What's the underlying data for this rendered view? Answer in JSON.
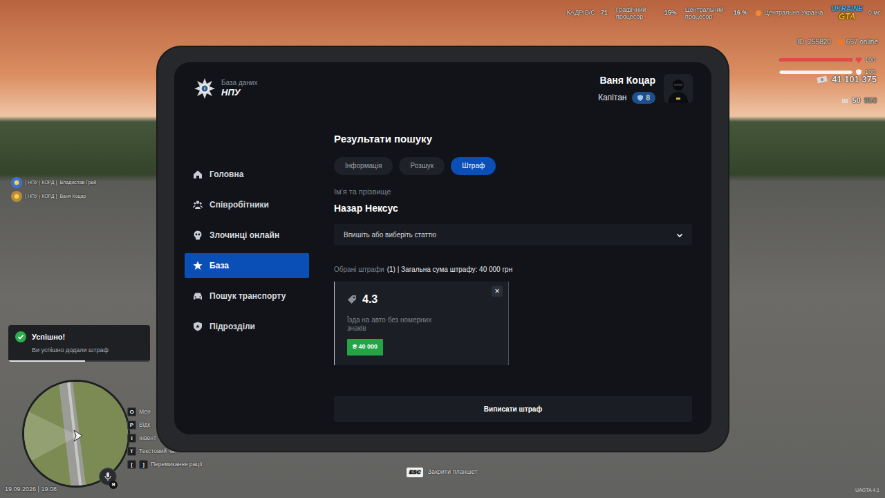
{
  "hud": {
    "fps": {
      "label": "КАДРІВ/С",
      "value": "71"
    },
    "gpu": {
      "label": "Графічний процесор",
      "value": "15%"
    },
    "cpu": {
      "label": "Центральний процесор",
      "value": "16 %"
    },
    "server": "Центральна Україна",
    "logo": [
      "UKRAINE",
      "GTA"
    ],
    "ping": "0 мс",
    "id": "ID: 255820",
    "online": "657 online",
    "health": {
      "reading": "100",
      "level": 1
    },
    "armor": {
      "reading": "100",
      "level": 1
    },
    "money": "41 101 375",
    "ammo": "50",
    "ammo_reserve": "950",
    "version": "UAGTA 4.1"
  },
  "players": [
    {
      "tag": "[ НПУ | КОРД ]",
      "name": "Владислав Грей"
    },
    {
      "tag": "[ НПУ | КОРД ]",
      "name": "Ваня Коцар"
    }
  ],
  "notification": {
    "title": "Успішно!",
    "text": "Ви успішно додали штраф",
    "level": 0.54
  },
  "keys": [
    {
      "keys": [
        "O"
      ],
      "label": "Мен"
    },
    {
      "keys": [
        "P"
      ],
      "label": "Відк"
    },
    {
      "keys": [
        "I"
      ],
      "label": "Інвент"
    },
    {
      "keys": [
        "T"
      ],
      "label": "Текстовий чат"
    },
    {
      "keys": [
        "[",
        "]"
      ],
      "label": "Перемикання рації"
    }
  ],
  "mic_key": "Я",
  "datetime": "19.09.2026 | 19:08",
  "close_hint": {
    "key": "ESC",
    "label": "Закрити планшет"
  },
  "tablet": {
    "brand": {
      "subtitle": "База даних",
      "title": "НПУ"
    },
    "user": {
      "name": "Ваня Коцар",
      "rank": "Капітан",
      "level": "8"
    },
    "sidebar": [
      {
        "label": "Головна",
        "selected": false
      },
      {
        "label": "Співробітники",
        "selected": false
      },
      {
        "label": "Злочинці онлайн",
        "selected": false
      },
      {
        "label": "База",
        "selected": true
      },
      {
        "label": "Пошук транспорту",
        "selected": false
      },
      {
        "label": "Підрозділи",
        "selected": false
      }
    ],
    "page": {
      "title": "Результати пошуку",
      "tabs": [
        {
          "label": "Інформація",
          "selected": false
        },
        {
          "label": "Розшук",
          "selected": false
        },
        {
          "label": "Штраф",
          "selected": true
        }
      ],
      "name_label": "Ім'я та прізвище",
      "name": "Назар Нексус",
      "article_placeholder": "Впишіть або виберіть статтю",
      "fines_label": "Обрані штрафи",
      "fines_summary": "(1) | Загальна сума штрафу: 40 000 грн",
      "fines": [
        {
          "article": "4.3",
          "description": "Їзда на авто без номерних знаків",
          "amount": "₴ 40 000",
          "remove": "×"
        }
      ],
      "submit": "Виписати штраф"
    }
  }
}
